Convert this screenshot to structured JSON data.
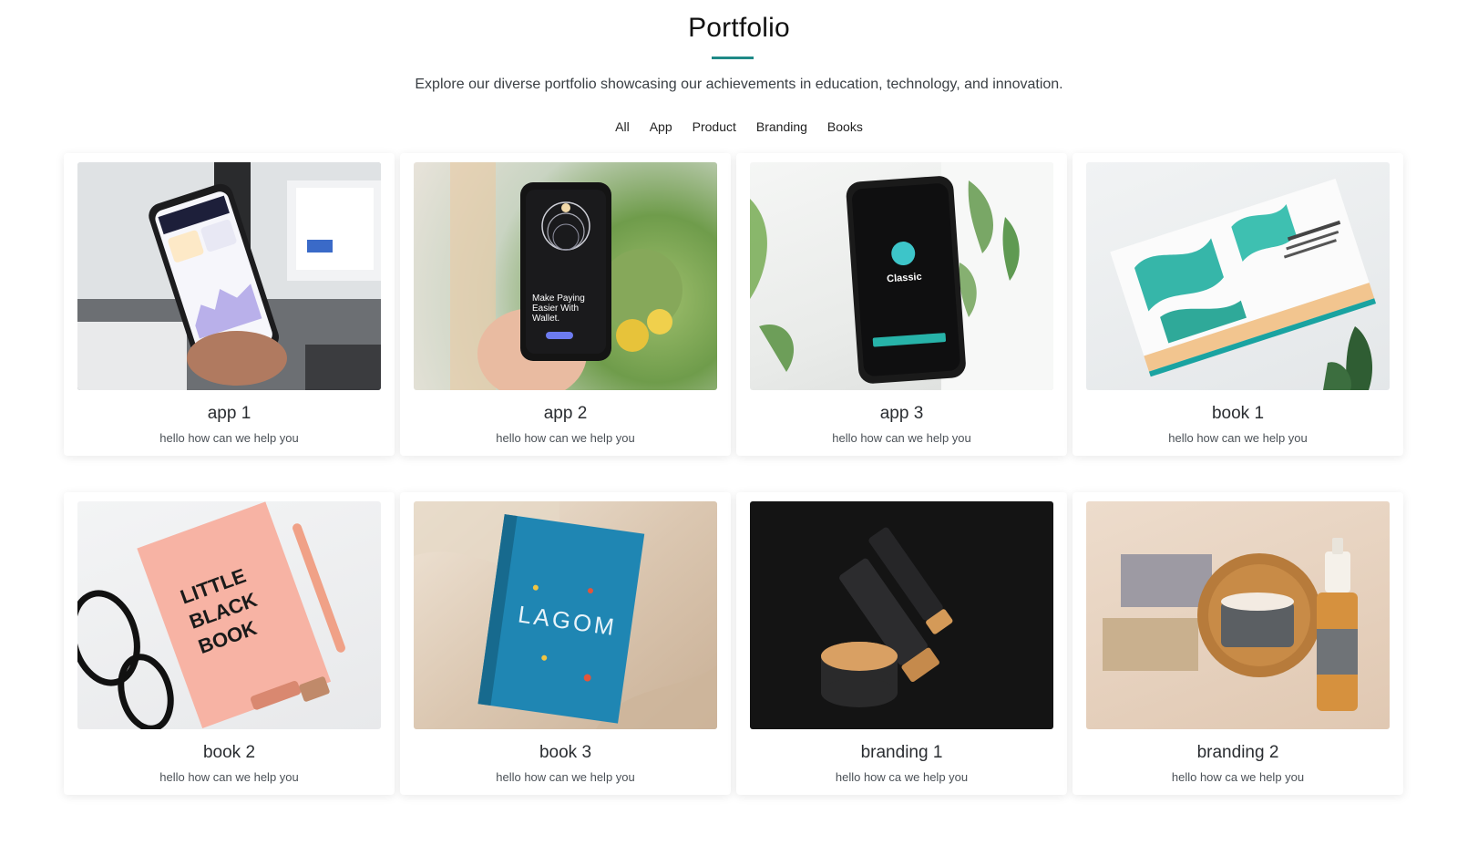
{
  "page": {
    "title": "Portfolio",
    "subtitle": "Explore our diverse portfolio showcasing our achievements in education, technology, and innovation."
  },
  "filters": [
    "All",
    "App",
    "Product",
    "Branding",
    "Books"
  ],
  "items": [
    {
      "title": "app 1",
      "description": "hello how can we help you",
      "image": "phone-weather-app-photo"
    },
    {
      "title": "app 2",
      "description": "hello how can we help you",
      "image": "phone-wallet-app-photo",
      "image_text": [
        "Make Paying",
        "Easier With",
        "Wallet."
      ]
    },
    {
      "title": "app 3",
      "description": "hello how can we help you",
      "image": "phone-classic-app-photo",
      "image_text": [
        "Classic"
      ]
    },
    {
      "title": "book 1",
      "description": "hello how can we help you",
      "image": "green-book-photo"
    },
    {
      "title": "book 2",
      "description": "hello how can we help you",
      "image": "little-black-book-photo",
      "image_text": [
        "LITTLE",
        "BLACK",
        "BOOK"
      ]
    },
    {
      "title": "book 3",
      "description": "hello how can we help you",
      "image": "lagom-book-photo",
      "image_text": [
        "LAGOM"
      ]
    },
    {
      "title": "branding 1",
      "description": "hello how ca we help you",
      "image": "cosmetic-tubes-photo"
    },
    {
      "title": "branding 2",
      "description": "hello how ca we help you",
      "image": "cosmetic-set-photo"
    }
  ],
  "colors": {
    "accent": "#1f8a87",
    "text": "#212529"
  }
}
